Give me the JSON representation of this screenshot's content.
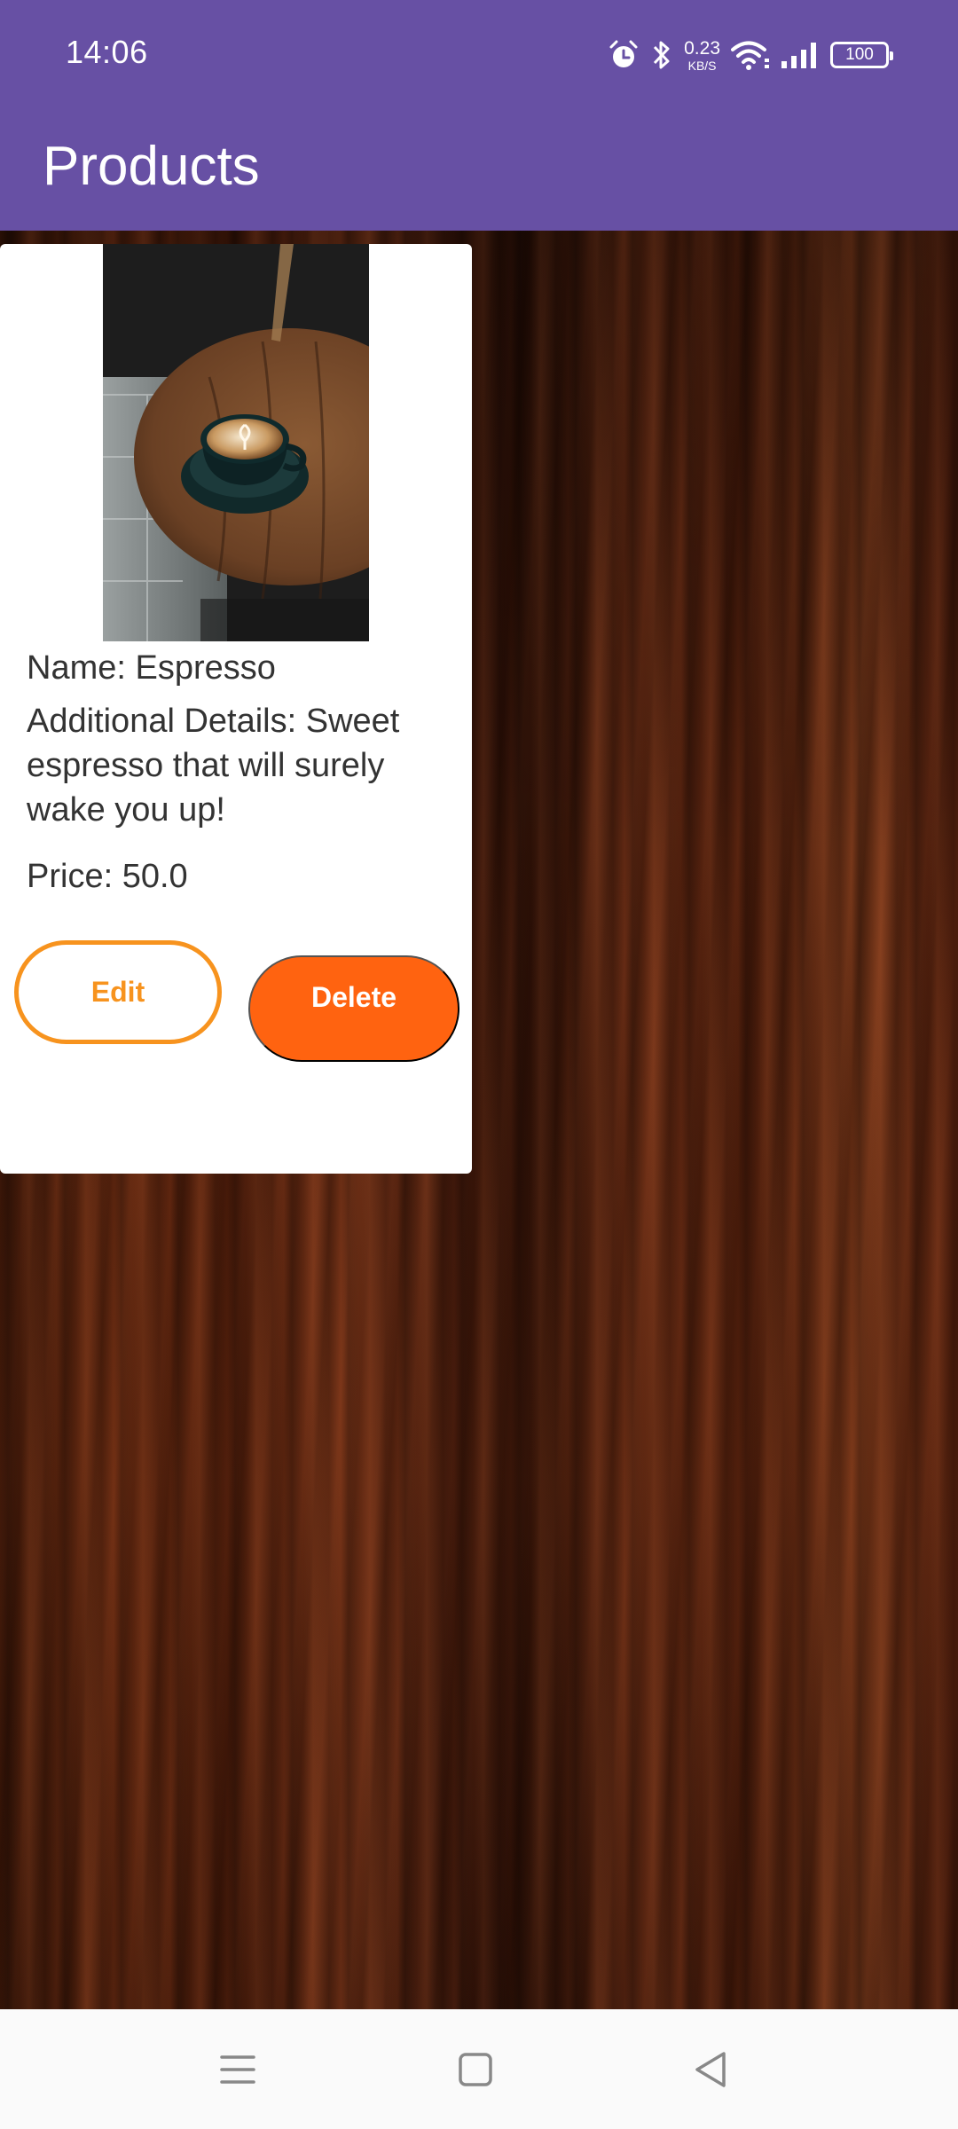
{
  "status_bar": {
    "time": "14:06",
    "net_speed": "0.23",
    "net_unit": "KB/S",
    "battery": "100",
    "icons": [
      "alarm-icon",
      "bluetooth-icon",
      "wifi-icon",
      "signal-icon",
      "battery-icon"
    ]
  },
  "app_bar": {
    "title": "Products",
    "color": "#6750a4"
  },
  "product": {
    "image": "espresso-cup-photo",
    "name": "Name: Espresso",
    "details": "Additional Details: Sweet espresso that will surely wake you up!",
    "price": "Price: 50.0",
    "edit_label": "Edit",
    "delete_label": "Delete",
    "edit_color": "#f7931e",
    "delete_color": "#ff6310"
  },
  "nav_bar": {
    "buttons": [
      "menu-icon",
      "home-icon",
      "back-icon"
    ]
  }
}
